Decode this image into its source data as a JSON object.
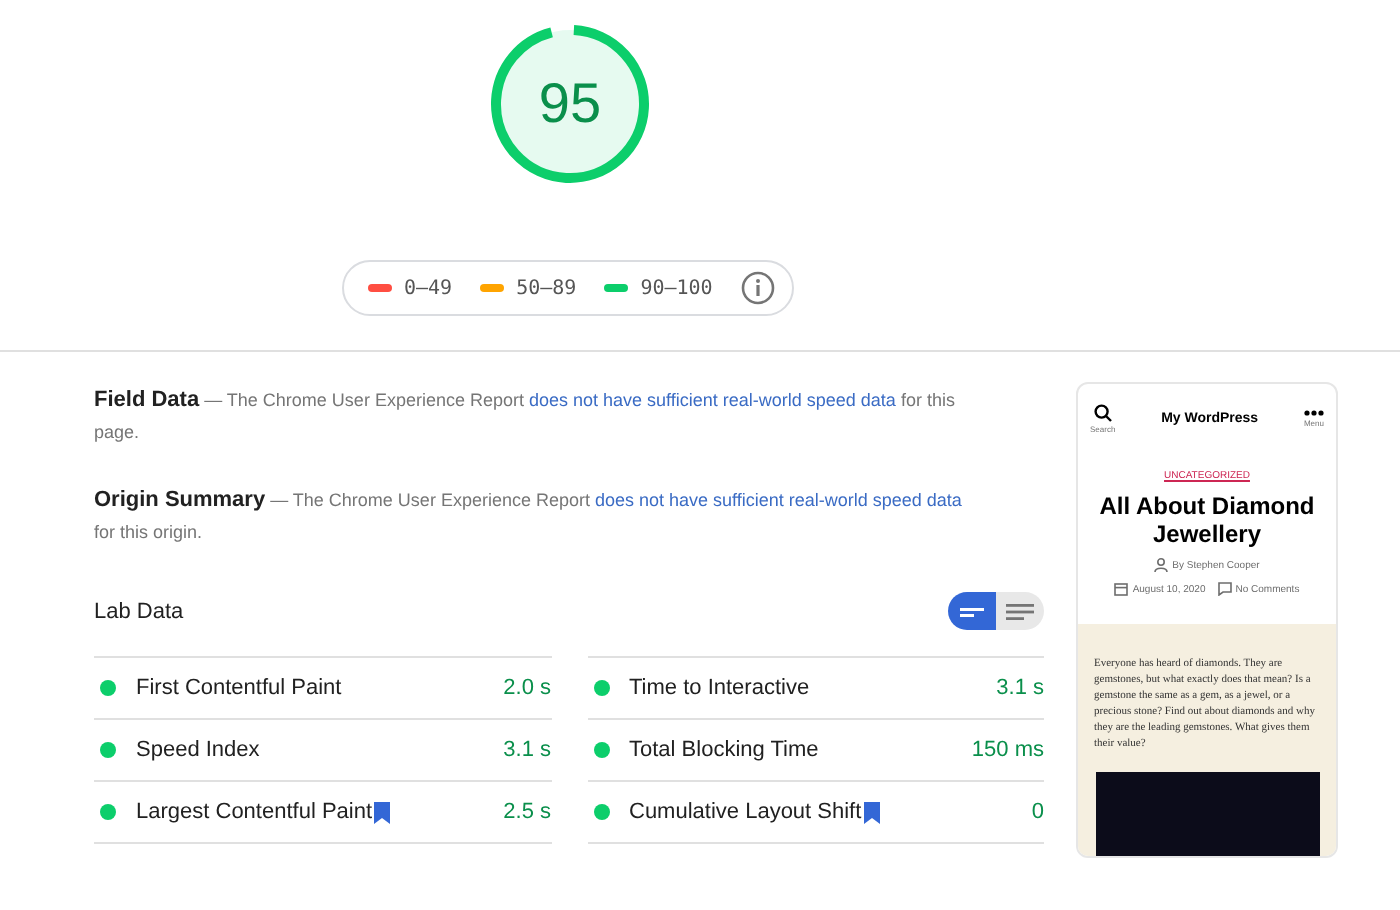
{
  "gauge": {
    "score": "95",
    "level": 0.95,
    "color": "#0cce6b"
  },
  "legend": [
    {
      "label": "0–49",
      "color": "#ff4e42"
    },
    {
      "label": "50–89",
      "color": "#ffa400"
    },
    {
      "label": "90–100",
      "color": "#0cce6b"
    }
  ],
  "field_data": {
    "title": "Field Data",
    "text_before": "— The Chrome User Experience Report ",
    "link": "does not have sufficient real-world speed data",
    "text_after": " for this page."
  },
  "origin_summary": {
    "title": "Origin Summary",
    "text_before": "— The Chrome User Experience Report ",
    "link": "does not have sufficient real-world speed data",
    "text_after": " for this origin."
  },
  "lab_data": {
    "title": "Lab Data",
    "view_toggle": [
      {
        "kind": "compact",
        "selected": true
      },
      {
        "kind": "list",
        "selected": false
      }
    ],
    "metrics": [
      {
        "name": "First Contentful Paint",
        "value": "2.0 s",
        "color": "#0cce6b",
        "flagged": false
      },
      {
        "name": "Time to Interactive",
        "value": "3.1 s",
        "color": "#0cce6b",
        "flagged": false
      },
      {
        "name": "Speed Index",
        "value": "3.1 s",
        "color": "#0cce6b",
        "flagged": false
      },
      {
        "name": "Total Blocking Time",
        "value": "150 ms",
        "color": "#0cce6b",
        "flagged": false
      },
      {
        "name": "Largest Contentful Paint",
        "value": "2.5 s",
        "color": "#0cce6b",
        "flagged": true
      },
      {
        "name": "Cumulative Layout Shift",
        "value": "0",
        "color": "#0cce6b",
        "flagged": true
      }
    ]
  },
  "preview": {
    "search_label": "Search",
    "site_title": "My WordPress",
    "menu_label": "Menu",
    "category": "UNCATEGORIZED",
    "post_title": "All About Diamond Jewellery",
    "author": "By Stephen Cooper",
    "date": "August 10, 2020",
    "comments": "No Comments",
    "excerpt": "Everyone has heard of diamonds. They are gemstones, but what exactly does that mean? Is a gemstone the same as a gem, as a jewel, or a precious stone? Find out about diamonds and why they are the leading gemstones. What gives them their value?"
  }
}
